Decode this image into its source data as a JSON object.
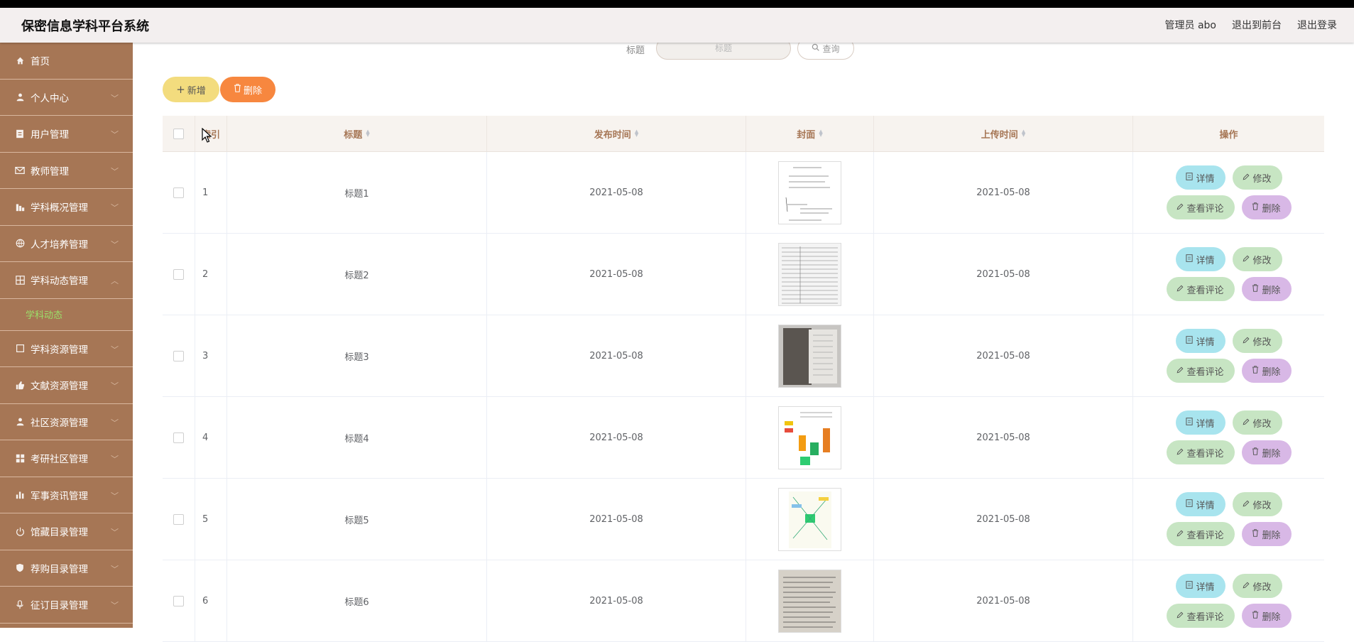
{
  "app": {
    "title": "保密信息学科平台系统",
    "header_links": [
      "管理员 abo",
      "退出到前台",
      "退出登录"
    ]
  },
  "sidebar": {
    "items": [
      {
        "label": "首页",
        "icon": "home-icon",
        "expandable": false
      },
      {
        "label": "个人中心",
        "icon": "user-icon",
        "expandable": true
      },
      {
        "label": "用户管理",
        "icon": "document-icon",
        "expandable": true
      },
      {
        "label": "教师管理",
        "icon": "mail-icon",
        "expandable": true
      },
      {
        "label": "学科概况管理",
        "icon": "bar-chart-icon",
        "expandable": true
      },
      {
        "label": "人才培养管理",
        "icon": "globe-icon",
        "expandable": true
      },
      {
        "label": "学科动态管理",
        "icon": "grid-icon",
        "expandable": true,
        "expanded": true
      }
    ],
    "subitem": "学科动态",
    "items_after": [
      {
        "label": "学科资源管理",
        "icon": "square-icon"
      },
      {
        "label": "文献资源管理",
        "icon": "thumb-up-icon"
      },
      {
        "label": "社区资源管理",
        "icon": "user-icon"
      },
      {
        "label": "考研社区管理",
        "icon": "apps-icon"
      },
      {
        "label": "军事资讯管理",
        "icon": "stats-icon"
      },
      {
        "label": "馆藏目录管理",
        "icon": "power-icon"
      },
      {
        "label": "荐购目录管理",
        "icon": "shield-icon"
      },
      {
        "label": "征订目录管理",
        "icon": "mic-icon"
      }
    ]
  },
  "search": {
    "label": "标题",
    "placeholder": "标题",
    "button": "查询"
  },
  "toolbar": {
    "add": "新增",
    "delete": "删除"
  },
  "table": {
    "headers": [
      "索引",
      "标题",
      "发布时间",
      "封面",
      "上传时间",
      "操作"
    ],
    "rows": [
      {
        "index": "1",
        "title": "标题1",
        "publish": "2021-05-08",
        "upload": "2021-05-08"
      },
      {
        "index": "2",
        "title": "标题2",
        "publish": "2021-05-08",
        "upload": "2021-05-08"
      },
      {
        "index": "3",
        "title": "标题3",
        "publish": "2021-05-08",
        "upload": "2021-05-08"
      },
      {
        "index": "4",
        "title": "标题4",
        "publish": "2021-05-08",
        "upload": "2021-05-08"
      },
      {
        "index": "5",
        "title": "标题5",
        "publish": "2021-05-08",
        "upload": "2021-05-08"
      },
      {
        "index": "6",
        "title": "标题6",
        "publish": "2021-05-08",
        "upload": "2021-05-08"
      }
    ],
    "actions": {
      "detail": "详情",
      "edit": "修改",
      "comment": "查看评论",
      "remove": "删除"
    }
  },
  "colors": {
    "sidebar_bg": "#a67655",
    "accent_text": "#a67655",
    "add_btn": "#f3dc7e",
    "delete_btn": "#f7873f",
    "detail_btn": "#a8e4ee",
    "edit_btn": "#c7e5c3",
    "remove_btn": "#d8b8e6",
    "active_sub": "#9be06a"
  }
}
